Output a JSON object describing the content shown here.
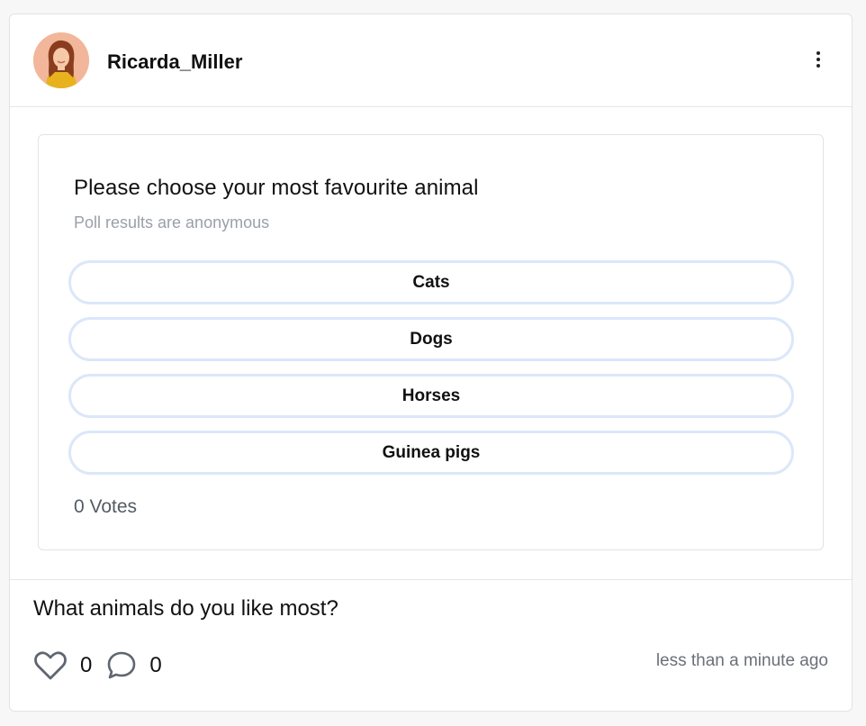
{
  "post": {
    "author": "Ricarda_Miller",
    "caption": "What animals do you like most?",
    "likes": "0",
    "comments": "0",
    "timestamp": "less than a minute ago"
  },
  "poll": {
    "question": "Please choose your most favourite animal",
    "note": "Poll results are anonymous",
    "options": [
      "Cats",
      "Dogs",
      "Horses",
      "Guinea pigs"
    ],
    "votes": "0 Votes"
  },
  "icons": {
    "more": "vertical-ellipsis-icon",
    "like": "heart-icon",
    "comment": "speech-bubble-icon"
  },
  "colors": {
    "option_border": "#dbe7fa",
    "muted_text": "#9aa0a8",
    "icon": "#5f6670"
  }
}
